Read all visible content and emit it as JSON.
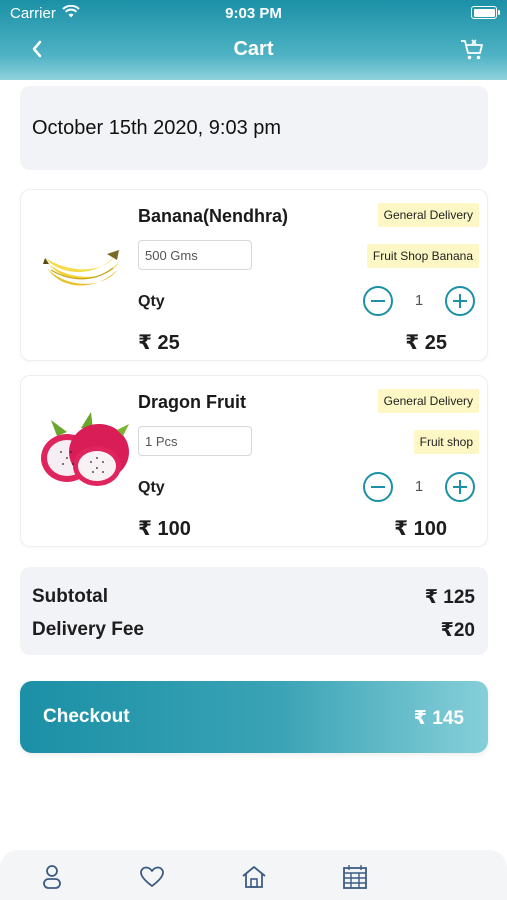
{
  "status_bar": {
    "carrier": "Carrier",
    "time": "9:03 PM"
  },
  "navbar": {
    "title": "Cart"
  },
  "order_date": "October 15th 2020, 9:03 pm",
  "cart_items": [
    {
      "name": "Banana(Nendhra)",
      "weight": "500 Gms",
      "delivery_tag": "General Delivery",
      "shop_tag": "Fruit Shop Banana",
      "qty_label": "Qty",
      "quantity": "1",
      "price": "₹ 25",
      "total": "₹ 25"
    },
    {
      "name": "Dragon Fruit",
      "weight": "1 Pcs",
      "delivery_tag": "General Delivery",
      "shop_tag": "Fruit shop",
      "qty_label": "Qty",
      "quantity": "1",
      "price": "₹ 100",
      "total": "₹ 100"
    }
  ],
  "summary": {
    "subtotal_label": "Subtotal",
    "subtotal_value": "₹ 125",
    "delivery_label": "Delivery Fee",
    "delivery_value": "₹20"
  },
  "checkout": {
    "label": "Checkout",
    "amount": "₹ 145"
  },
  "tabbar": {
    "items": [
      "profile-icon",
      "heart-icon",
      "home-icon",
      "calendar-icon"
    ]
  },
  "colors": {
    "primary": "#1b90a6",
    "tag_bg": "#fcf7c4",
    "panel_bg": "#f2f3f6"
  }
}
